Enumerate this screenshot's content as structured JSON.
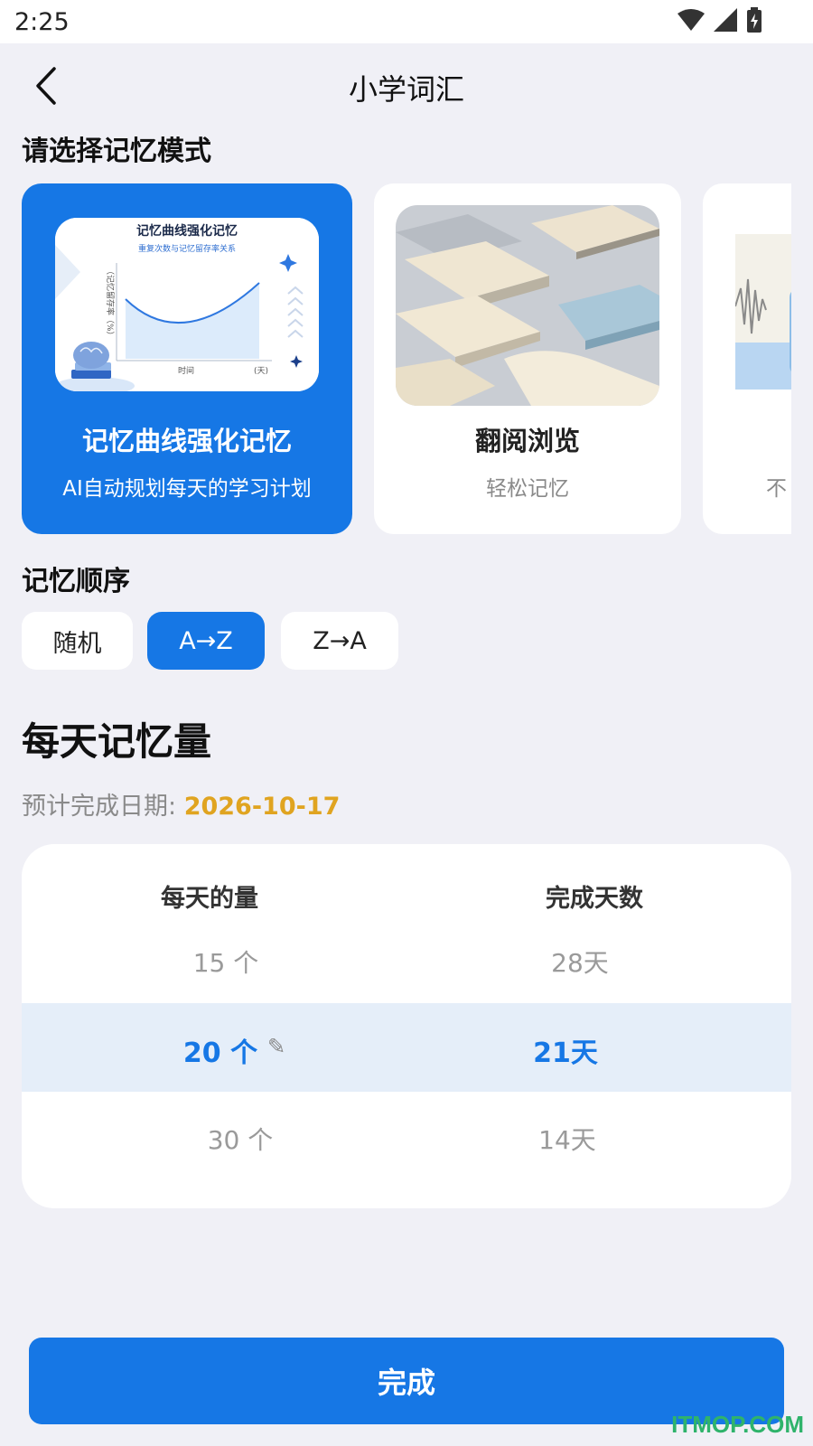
{
  "status_bar": {
    "time": "2:25"
  },
  "header": {
    "title": "小学词汇"
  },
  "mode_section": {
    "title": "请选择记忆模式",
    "cards": [
      {
        "title": "记忆曲线强化记忆",
        "subtitle": "AI自动规划每天的学习计划",
        "selected": true,
        "image": {
          "title": "记忆曲线强化记忆",
          "subtitle": "重复次数与记忆留存率关系",
          "ylabel": "（记忆留存率（%）",
          "xlabel": "时间",
          "xunit": "(天)"
        }
      },
      {
        "title": "翻阅浏览",
        "subtitle": "轻松记忆",
        "selected": false
      },
      {
        "title": "",
        "subtitle": "不",
        "selected": false
      }
    ]
  },
  "order_section": {
    "title": "记忆顺序",
    "options": [
      "随机",
      "A→Z",
      "Z→A"
    ],
    "selected": "A→Z"
  },
  "daily_section": {
    "title": "每天记忆量",
    "finish_label": "预计完成日期: ",
    "finish_date": "2026-10-17"
  },
  "picker": {
    "col_per_day": "每天的量",
    "col_days": "完成天数",
    "per_day_items": [
      "15 个",
      "20 个",
      "30 个"
    ],
    "days_items": [
      "28天",
      "21天",
      "14天"
    ],
    "selected_index": 1
  },
  "done_label": "完成",
  "watermark": "ITMOP.COM",
  "colors": {
    "accent": "#1677e5",
    "date": "#e0a420",
    "background": "#f0f0f6"
  }
}
